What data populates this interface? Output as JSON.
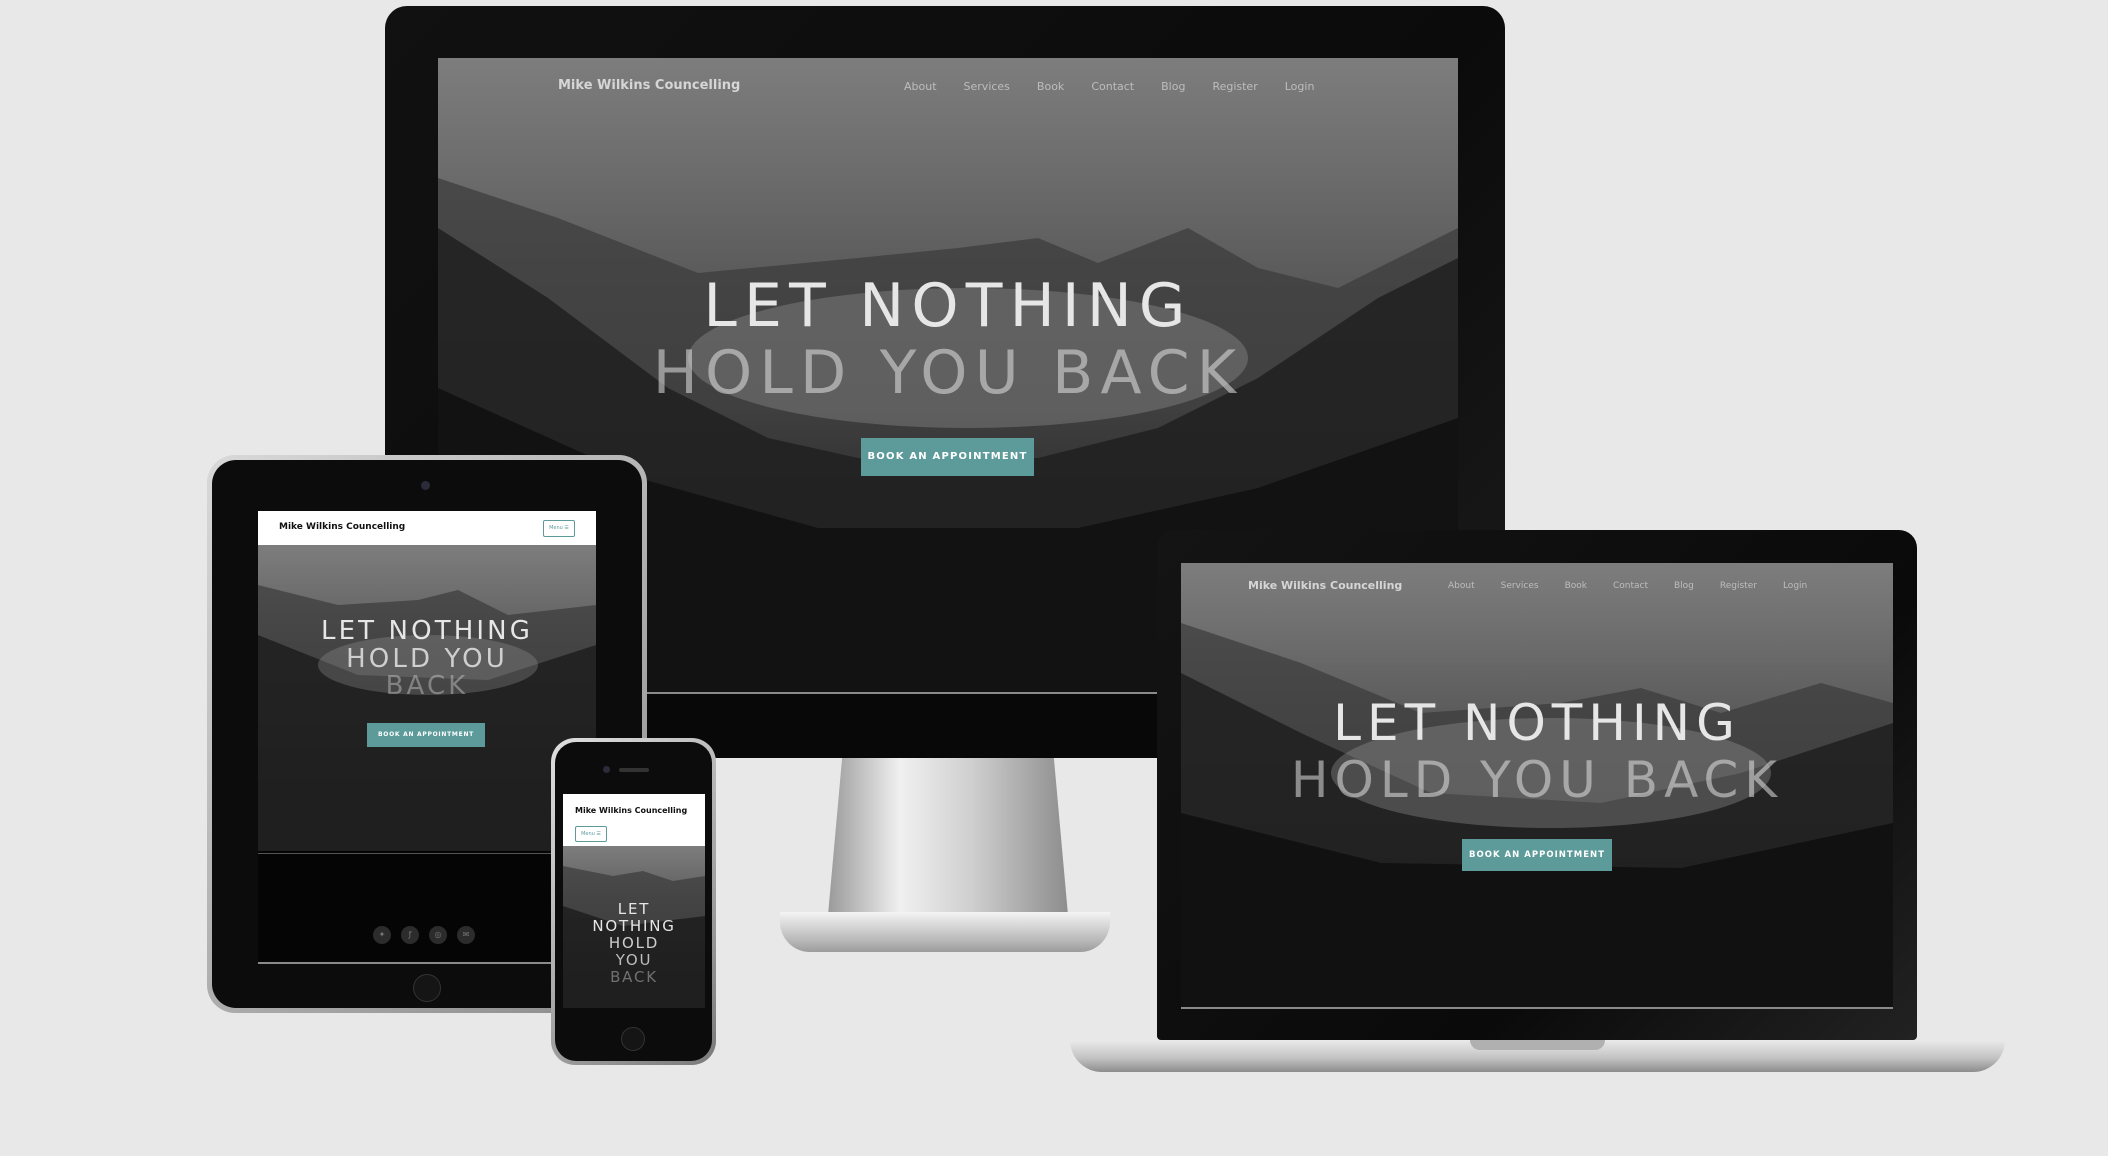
{
  "site": {
    "brand": "Mike Wilkins Councelling",
    "nav": [
      "About",
      "Services",
      "Book",
      "Contact",
      "Blog",
      "Register",
      "Login"
    ],
    "headline_line1": "LET NOTHING",
    "headline_line2": "HOLD YOU BACK",
    "cta": "BOOK AN APPOINTMENT",
    "menu_button": "Menu ☰",
    "tablet_line1": "LET NOTHING",
    "tablet_line2": "HOLD YOU",
    "tablet_line3": "BACK",
    "phone_words": [
      "LET",
      "NOTHING",
      "HOLD",
      "YOU",
      "BACK"
    ]
  },
  "social_icons": [
    "twitter-icon",
    "facebook-icon",
    "instagram-icon",
    "email-icon"
  ],
  "colors": {
    "accent": "#5d9b9b",
    "background": "#e8e8e8",
    "bezel": "#0a0a0a"
  }
}
